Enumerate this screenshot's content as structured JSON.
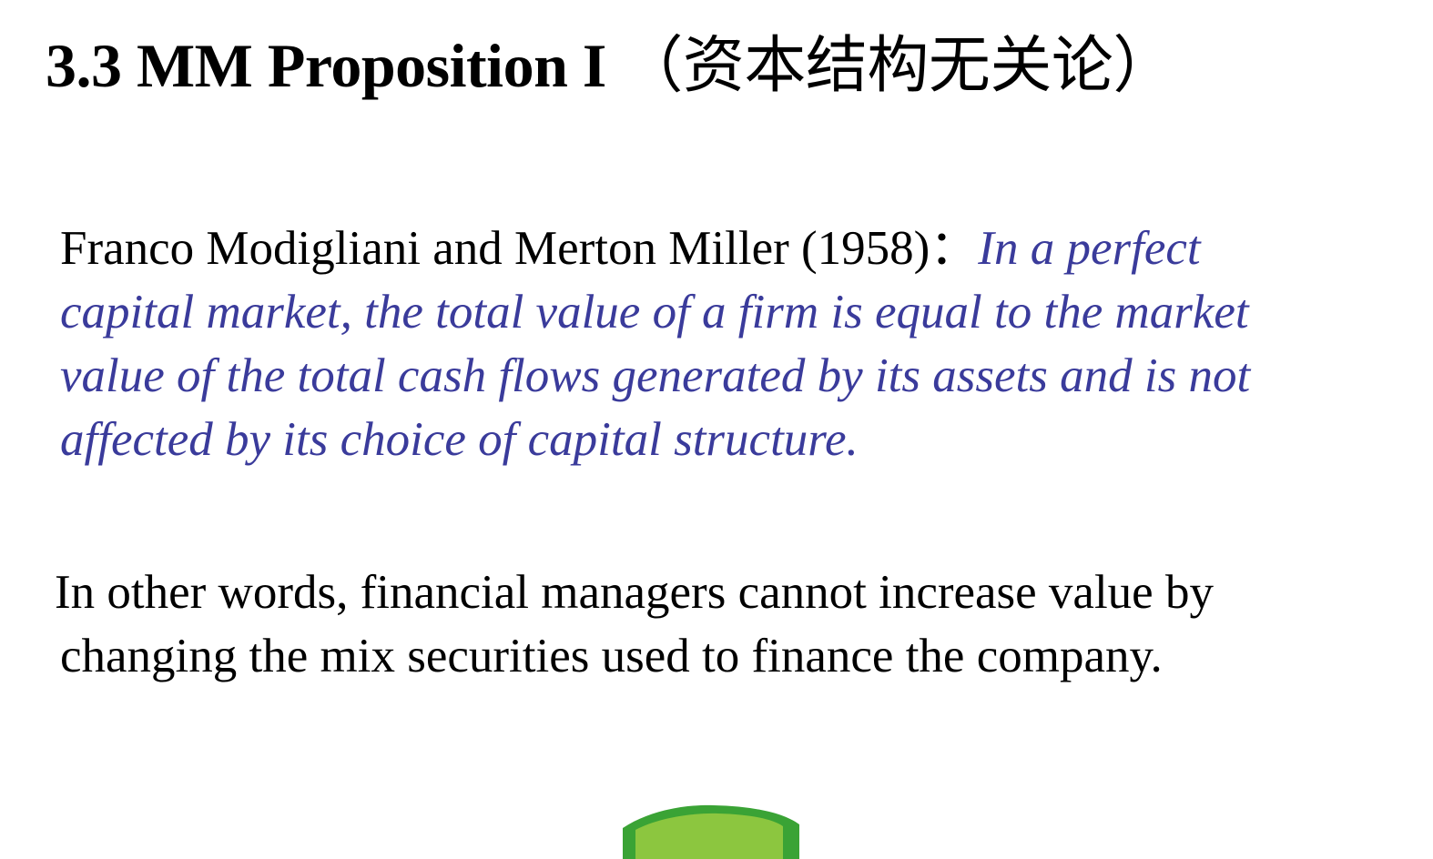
{
  "slide": {
    "title_latin": "3.3 MM Proposition I",
    "title_cjk": "（资本结构无关论）",
    "attribution": "Franco Modigliani and Merton Miller (1958)：",
    "proposition_lines": [
      "In a perfect",
      "capital market, the total value of a firm is equal to the market",
      "value of the total cash flows generated by its assets and is not",
      "affected by its choice of capital structure."
    ],
    "restatement_lines": [
      "In other words, financial managers cannot increase value by",
      "changing the mix securities used to finance the company."
    ]
  },
  "colors": {
    "text": "#000000",
    "quote_blue": "#3a3b9b",
    "decor_green_outer": "#3aa335",
    "decor_green_inner": "#8cc63f",
    "background": "#ffffff"
  }
}
